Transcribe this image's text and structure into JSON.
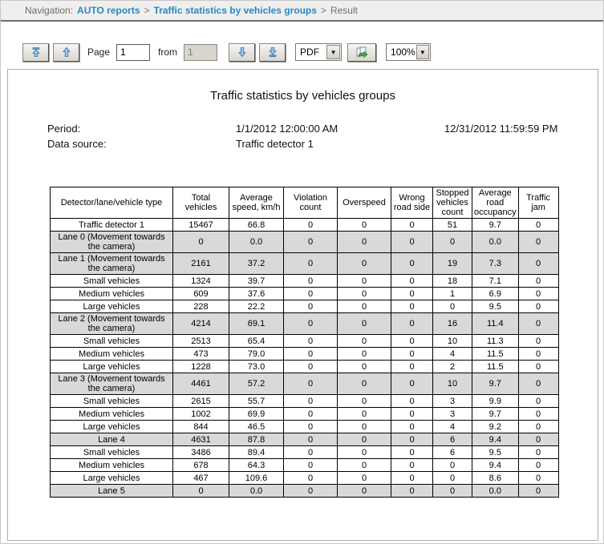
{
  "nav": {
    "label": "Navigation:",
    "crumb_reports": "AUTO reports",
    "sep1": ">",
    "crumb_report": "Traffic statistics by vehicles groups",
    "sep2": ">",
    "crumb_result": "Result"
  },
  "toolbar": {
    "first_page_icon": "first-page-up-arrow",
    "prev_page_icon": "up-arrow",
    "page_label": "Page",
    "page_value": "1",
    "from_label": "from",
    "total_pages_value": "1",
    "next_page_icon": "down-arrow",
    "last_page_icon": "last-page-down-arrow",
    "format_selected": "PDF",
    "export_icon": "export-report",
    "zoom_selected": "100%",
    "dropdown_glyph": "▼"
  },
  "report": {
    "title": "Traffic statistics by vehicles groups",
    "period_label": "Period:",
    "period_start": "1/1/2012 12:00:00 AM",
    "period_end": "12/31/2012 11:59:59 PM",
    "data_source_label": "Data source:",
    "data_source_value": "Traffic detector 1"
  },
  "colors": {
    "link_blue": "#2688c3",
    "shaded_row": "#d9d9d9",
    "navbar_bg": "#f0efed",
    "arrow_blue": "#5b9bd5"
  },
  "table": {
    "headers": [
      "Detector/lane/vehicle type",
      "Total vehicles",
      "Average speed, km/h",
      "Violation count",
      "Overspeed",
      "Wrong road side",
      "Stopped vehicles count",
      "Average road occupancy",
      "Traffic jam"
    ],
    "rows": [
      {
        "label": "Traffic detector 1",
        "shaded": false,
        "values": [
          "15467",
          "66.8",
          "0",
          "0",
          "0",
          "51",
          "9.7",
          "0"
        ]
      },
      {
        "label": "Lane 0 (Movement towards the camera)",
        "shaded": true,
        "values": [
          "0",
          "0.0",
          "0",
          "0",
          "0",
          "0",
          "0.0",
          "0"
        ]
      },
      {
        "label": "Lane 1 (Movement towards the camera)",
        "shaded": true,
        "values": [
          "2161",
          "37.2",
          "0",
          "0",
          "0",
          "19",
          "7.3",
          "0"
        ]
      },
      {
        "label": "Small vehicles",
        "shaded": false,
        "values": [
          "1324",
          "39.7",
          "0",
          "0",
          "0",
          "18",
          "7.1",
          "0"
        ]
      },
      {
        "label": "Medium vehicles",
        "shaded": false,
        "values": [
          "609",
          "37.6",
          "0",
          "0",
          "0",
          "1",
          "6.9",
          "0"
        ]
      },
      {
        "label": "Large vehicles",
        "shaded": false,
        "values": [
          "228",
          "22.2",
          "0",
          "0",
          "0",
          "0",
          "9.5",
          "0"
        ]
      },
      {
        "label": "Lane 2 (Movement towards the camera)",
        "shaded": true,
        "values": [
          "4214",
          "69.1",
          "0",
          "0",
          "0",
          "16",
          "11.4",
          "0"
        ]
      },
      {
        "label": "Small vehicles",
        "shaded": false,
        "values": [
          "2513",
          "65.4",
          "0",
          "0",
          "0",
          "10",
          "11.3",
          "0"
        ]
      },
      {
        "label": "Medium vehicles",
        "shaded": false,
        "values": [
          "473",
          "79.0",
          "0",
          "0",
          "0",
          "4",
          "11.5",
          "0"
        ]
      },
      {
        "label": "Large vehicles",
        "shaded": false,
        "values": [
          "1228",
          "73.0",
          "0",
          "0",
          "0",
          "2",
          "11.5",
          "0"
        ]
      },
      {
        "label": "Lane 3 (Movement towards the camera)",
        "shaded": true,
        "values": [
          "4461",
          "57.2",
          "0",
          "0",
          "0",
          "10",
          "9.7",
          "0"
        ]
      },
      {
        "label": "Small vehicles",
        "shaded": false,
        "values": [
          "2615",
          "55.7",
          "0",
          "0",
          "0",
          "3",
          "9.9",
          "0"
        ]
      },
      {
        "label": "Medium vehicles",
        "shaded": false,
        "values": [
          "1002",
          "69.9",
          "0",
          "0",
          "0",
          "3",
          "9.7",
          "0"
        ]
      },
      {
        "label": "Large vehicles",
        "shaded": false,
        "values": [
          "844",
          "46.5",
          "0",
          "0",
          "0",
          "4",
          "9.2",
          "0"
        ]
      },
      {
        "label": "Lane 4",
        "shaded": true,
        "values": [
          "4631",
          "87.8",
          "0",
          "0",
          "0",
          "6",
          "9.4",
          "0"
        ]
      },
      {
        "label": "Small vehicles",
        "shaded": false,
        "values": [
          "3486",
          "89.4",
          "0",
          "0",
          "0",
          "6",
          "9.5",
          "0"
        ]
      },
      {
        "label": "Medium vehicles",
        "shaded": false,
        "values": [
          "678",
          "64.3",
          "0",
          "0",
          "0",
          "0",
          "9.4",
          "0"
        ]
      },
      {
        "label": "Large vehicles",
        "shaded": false,
        "values": [
          "467",
          "109.6",
          "0",
          "0",
          "0",
          "0",
          "8.6",
          "0"
        ]
      },
      {
        "label": "Lane 5",
        "shaded": true,
        "values": [
          "0",
          "0.0",
          "0",
          "0",
          "0",
          "0",
          "0.0",
          "0"
        ]
      }
    ]
  }
}
